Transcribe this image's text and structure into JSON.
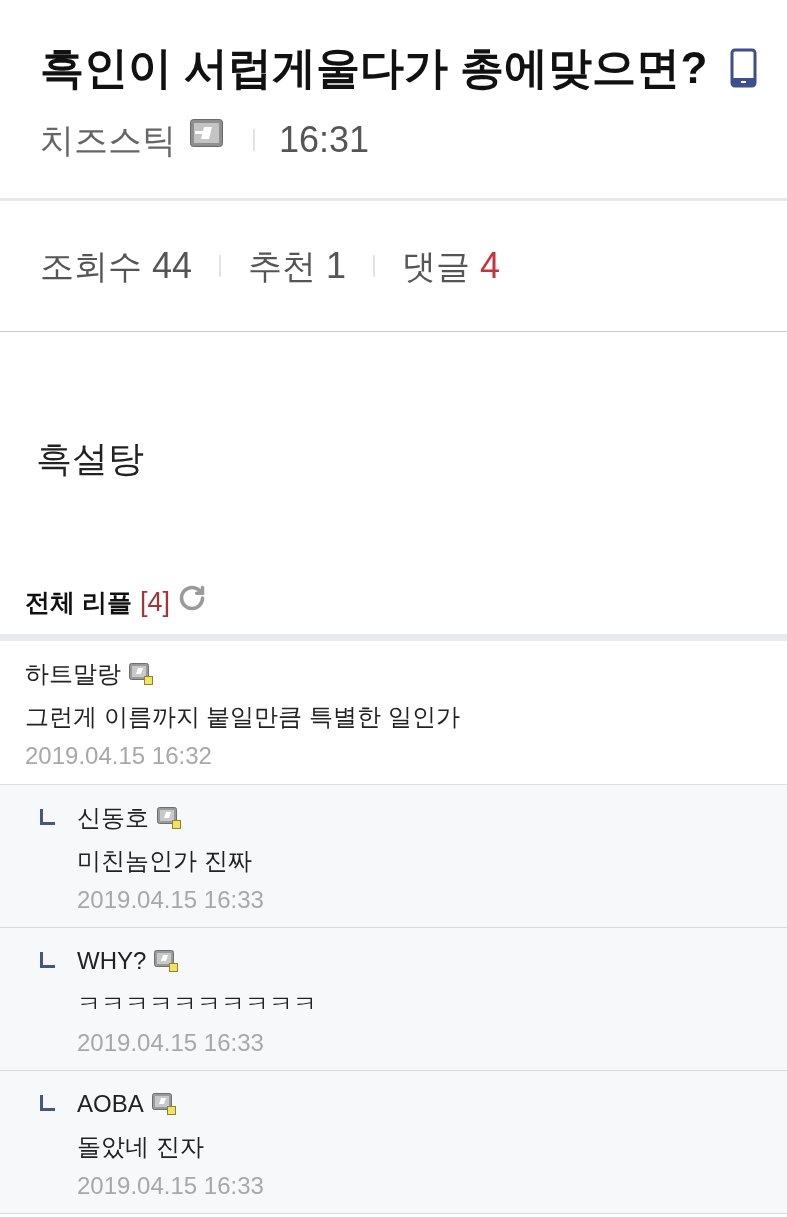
{
  "post": {
    "title": "흑인이 서럽게울다가 총에맞으면?",
    "author": "치즈스틱",
    "time": "16:31"
  },
  "stats": [
    {
      "label": "조회수",
      "value": "44",
      "color": "#555555"
    },
    {
      "label": "추천",
      "value": "1",
      "color": "#555555"
    },
    {
      "label": "댓글",
      "value": "4",
      "color": "#c4343c"
    }
  ],
  "body": "흑설탕",
  "comments_header": {
    "title": "전체 리플",
    "count": "[4]"
  },
  "comments": [
    {
      "kind": "comment",
      "author": "하트말랑",
      "text": "그런게 이름까지 붙일만큼 특별한 일인가",
      "date": "2019.04.15 16:32"
    },
    {
      "kind": "reply",
      "author": "신동호",
      "text": "미친놈인가 진짜",
      "date": "2019.04.15 16:33"
    },
    {
      "kind": "reply",
      "author": "WHY?",
      "text": "ㅋㅋㅋㅋㅋㅋㅋㅋㅋㅋ",
      "date": "2019.04.15 16:33"
    },
    {
      "kind": "reply",
      "author": "AOBA",
      "text": "돌았네 진자",
      "date": "2019.04.15 16:33"
    }
  ]
}
